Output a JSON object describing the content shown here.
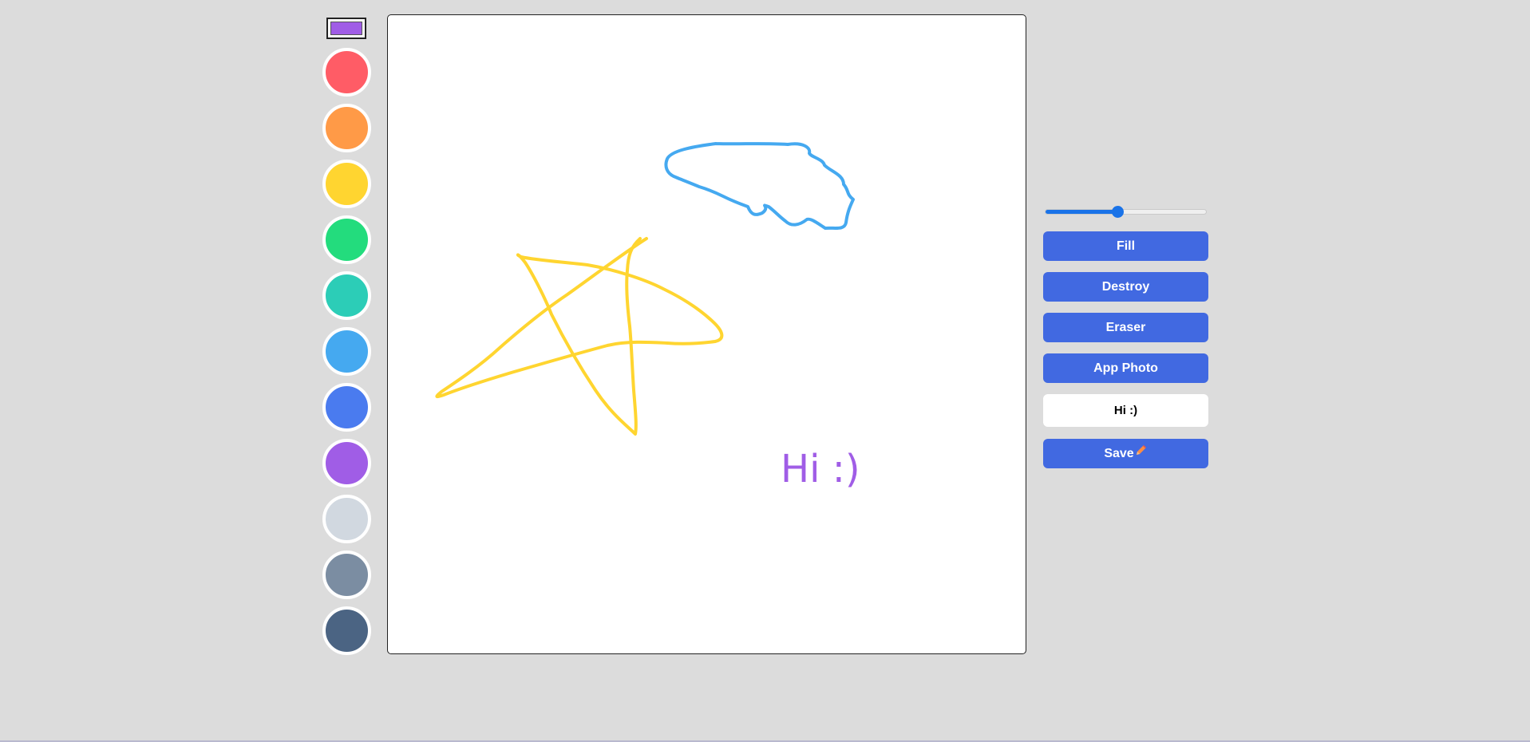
{
  "colors": {
    "background": "#dcdcdc",
    "selected": "#a05de6",
    "button": "#4169e1",
    "slider": "#1a73e8"
  },
  "palette": [
    {
      "name": "red",
      "hex": "#ff5c66"
    },
    {
      "name": "orange",
      "hex": "#ff9a47"
    },
    {
      "name": "yellow",
      "hex": "#ffd530"
    },
    {
      "name": "green",
      "hex": "#23dc7d"
    },
    {
      "name": "teal",
      "hex": "#2ccdb7"
    },
    {
      "name": "light-blue",
      "hex": "#45a9f0"
    },
    {
      "name": "blue",
      "hex": "#4a7bef"
    },
    {
      "name": "purple",
      "hex": "#a05de6"
    },
    {
      "name": "light-gray",
      "hex": "#d1d8e0"
    },
    {
      "name": "gray",
      "hex": "#7b8da2"
    },
    {
      "name": "slate",
      "hex": "#4b6483"
    }
  ],
  "canvas": {
    "text": "Hi :)",
    "text_color": "#a05de6",
    "strokes": [
      {
        "name": "star",
        "color": "#ffd530"
      },
      {
        "name": "cloud",
        "color": "#45a9f0"
      }
    ]
  },
  "controls": {
    "brush_size_percent": 45,
    "fill_label": "Fill",
    "destroy_label": "Destroy",
    "eraser_label": "Eraser",
    "app_photo_label": "App Photo",
    "text_input_value": "Hi :)",
    "save_label": "Save",
    "save_icon": "pencil-icon"
  }
}
